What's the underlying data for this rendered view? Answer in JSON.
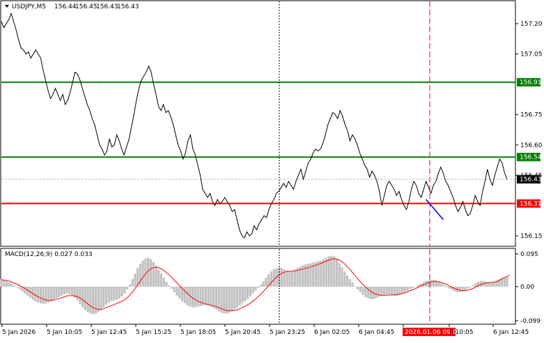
{
  "chart_data": [
    {
      "type": "line",
      "header": {
        "symbol": "USDJPY,M5",
        "ohlc": [
          "156.44",
          "156.45",
          "156.43",
          "156.43"
        ]
      },
      "ylim": [
        156.1,
        157.3
      ],
      "yticks": [
        "157.20",
        "157.05",
        "156.75",
        "156.60",
        "156.45",
        "156.15"
      ],
      "price_labels": [
        {
          "text": "156.91",
          "value": 156.91,
          "color": "#008000"
        },
        {
          "text": "156.54",
          "value": 156.54,
          "color": "#008000"
        },
        {
          "text": "156.43",
          "value": 156.43,
          "color": "#000000"
        },
        {
          "text": "156.31",
          "value": 156.31,
          "color": "#ff0000"
        }
      ],
      "hlines": [
        {
          "value": 156.91,
          "color": "#008000"
        },
        {
          "value": 156.54,
          "color": "#008000"
        },
        {
          "value": 156.31,
          "color": "#ff0000"
        },
        {
          "value": 156.43,
          "color": "#c0c0c0"
        }
      ],
      "x_labels": [
        "5 Jan 2026",
        "5 Jan 10:05",
        "5 Jan 12:45",
        "5 Jan 15:25",
        "5 Jan 18:05",
        "5 Jan 20:45",
        "5 Jan 23:25",
        "6 Jan 02:05",
        "6 Jan 04:45",
        "2026.01.06 09:00",
        "n 10:05",
        "6 Jan 12:45"
      ],
      "x_highlight_label": "2026.01.06 09:00",
      "vlines": [
        {
          "at": "5 Jan 23:25",
          "style": "dotted",
          "color": "#000000"
        },
        {
          "at": "2026.01.06 09:00",
          "style": "dashed",
          "color": "#ff0000"
        }
      ],
      "series": [
        {
          "color": "#000000",
          "y": [
            157.21,
            157.18,
            157.2,
            157.22,
            157.25,
            157.21,
            157.17,
            157.12,
            157.08,
            157.07,
            157.05,
            157.06,
            157.03,
            157.05,
            157.07,
            157.05,
            157.03,
            156.97,
            156.92,
            156.87,
            156.83,
            156.85,
            156.88,
            156.85,
            156.82,
            156.85,
            156.8,
            156.82,
            156.86,
            156.91,
            156.96,
            156.95,
            156.92,
            156.88,
            156.84,
            156.8,
            156.77,
            156.73,
            156.7,
            156.65,
            156.6,
            156.58,
            156.55,
            156.57,
            156.63,
            156.59,
            156.6,
            156.65,
            156.62,
            156.58,
            156.55,
            156.59,
            156.63,
            156.69,
            156.75,
            156.82,
            156.88,
            156.92,
            156.94,
            156.96,
            156.99,
            156.96,
            156.9,
            156.85,
            156.79,
            156.77,
            156.8,
            156.76,
            156.77,
            156.74,
            156.7,
            156.65,
            156.6,
            156.57,
            156.53,
            156.56,
            156.62,
            156.65,
            156.58,
            156.55,
            156.5,
            156.45,
            156.38,
            156.36,
            156.34,
            156.36,
            156.32,
            156.3,
            156.33,
            156.31,
            156.32,
            156.34,
            156.32,
            156.3,
            156.27,
            156.28,
            156.23,
            156.18,
            156.15,
            156.14,
            156.17,
            156.15,
            156.16,
            156.2,
            156.18,
            156.21,
            156.23,
            156.25,
            156.24,
            156.28,
            156.31,
            156.33,
            156.36,
            156.37,
            156.39,
            156.41,
            156.39,
            156.42,
            156.4,
            156.38,
            156.42,
            156.45,
            156.48,
            156.43,
            156.47,
            156.51,
            156.53,
            156.56,
            156.58,
            156.57,
            156.58,
            156.61,
            156.65,
            156.7,
            156.73,
            156.76,
            156.75,
            156.73,
            156.77,
            156.74,
            156.7,
            156.67,
            156.62,
            156.65,
            156.63,
            156.6,
            156.56,
            156.53,
            156.5,
            156.48,
            156.44,
            156.47,
            156.45,
            156.42,
            156.37,
            156.3,
            156.35,
            156.4,
            156.42,
            156.4,
            156.38,
            156.35,
            156.37,
            156.33,
            156.3,
            156.28,
            156.32,
            156.38,
            156.42,
            156.4,
            156.36,
            156.34,
            156.38,
            156.42,
            156.39,
            156.36,
            156.4,
            156.42,
            156.46,
            156.49,
            156.46,
            156.42,
            156.4,
            156.37,
            156.34,
            156.3,
            156.27,
            156.29,
            156.32,
            156.28,
            156.25,
            156.26,
            156.3,
            156.35,
            156.32,
            156.3,
            156.37,
            156.42,
            156.48,
            156.43,
            156.4,
            156.45,
            156.49,
            156.53,
            156.51,
            156.46,
            156.43
          ]
        }
      ],
      "segment": {
        "color": "#0000ff",
        "from_index": 173,
        "to_index": 180,
        "from_value": 156.33,
        "to_value": 156.23
      }
    },
    {
      "type": "bar",
      "title": "MACD(12,26,9) 0.027 0.033",
      "ylim": [
        -0.105,
        0.105
      ],
      "yticks": [
        "0.095",
        "0.00",
        "-0.099"
      ],
      "histogram_color": "#c0c0c0",
      "signal_color": "#ff0000",
      "histogram": [
        0.022,
        0.02,
        0.016,
        0.012,
        0.008,
        0.004,
        -0.002,
        -0.008,
        -0.014,
        -0.02,
        -0.026,
        -0.032,
        -0.038,
        -0.043,
        -0.046,
        -0.048,
        -0.05,
        -0.049,
        -0.046,
        -0.042,
        -0.038,
        -0.034,
        -0.03,
        -0.026,
        -0.022,
        -0.02,
        -0.022,
        -0.026,
        -0.032,
        -0.04,
        -0.05,
        -0.06,
        -0.068,
        -0.074,
        -0.078,
        -0.08,
        -0.079,
        -0.074,
        -0.068,
        -0.06,
        -0.052,
        -0.046,
        -0.042,
        -0.04,
        -0.038,
        -0.034,
        -0.028,
        -0.02,
        -0.008,
        0.006,
        0.022,
        0.038,
        0.054,
        0.066,
        0.076,
        0.082,
        0.084,
        0.08,
        0.072,
        0.062,
        0.05,
        0.038,
        0.026,
        0.014,
        0.004,
        -0.006,
        -0.016,
        -0.026,
        -0.034,
        -0.042,
        -0.048,
        -0.054,
        -0.058,
        -0.06,
        -0.06,
        -0.058,
        -0.056,
        -0.054,
        -0.054,
        -0.056,
        -0.058,
        -0.062,
        -0.066,
        -0.072,
        -0.076,
        -0.078,
        -0.078,
        -0.076,
        -0.072,
        -0.066,
        -0.06,
        -0.054,
        -0.048,
        -0.042,
        -0.036,
        -0.028,
        -0.02,
        -0.012,
        -0.004,
        0.006,
        0.016,
        0.026,
        0.036,
        0.044,
        0.05,
        0.054,
        0.056,
        0.054,
        0.05,
        0.046,
        0.044,
        0.046,
        0.05,
        0.054,
        0.058,
        0.062,
        0.064,
        0.066,
        0.068,
        0.07,
        0.072,
        0.074,
        0.076,
        0.08,
        0.084,
        0.088,
        0.09,
        0.088,
        0.08,
        0.068,
        0.056,
        0.044,
        0.032,
        0.022,
        0.012,
        0.002,
        -0.008,
        -0.016,
        -0.024,
        -0.03,
        -0.034,
        -0.036,
        -0.036,
        -0.034,
        -0.03,
        -0.026,
        -0.024,
        -0.022,
        -0.022,
        -0.024,
        -0.026,
        -0.026,
        -0.024,
        -0.02,
        -0.016,
        -0.012,
        -0.008,
        -0.004,
        0.0,
        0.004,
        0.008,
        0.012,
        0.016,
        0.018,
        0.02,
        0.02,
        0.018,
        0.014,
        0.01,
        0.004,
        -0.002,
        -0.006,
        -0.01,
        -0.014,
        -0.016,
        -0.016,
        -0.014,
        -0.01,
        -0.006,
        -0.002,
        0.004,
        0.01,
        0.014,
        0.016,
        0.016,
        0.014,
        0.012,
        0.012,
        0.014,
        0.018,
        0.022,
        0.026,
        0.027,
        0.028
      ],
      "signal": [
        0.02,
        0.019,
        0.018,
        0.016,
        0.013,
        0.01,
        0.007,
        0.003,
        -0.001,
        -0.005,
        -0.01,
        -0.015,
        -0.02,
        -0.025,
        -0.029,
        -0.033,
        -0.036,
        -0.039,
        -0.04,
        -0.04,
        -0.039,
        -0.037,
        -0.035,
        -0.032,
        -0.029,
        -0.027,
        -0.026,
        -0.026,
        -0.027,
        -0.029,
        -0.033,
        -0.038,
        -0.044,
        -0.05,
        -0.056,
        -0.061,
        -0.064,
        -0.066,
        -0.066,
        -0.064,
        -0.061,
        -0.058,
        -0.055,
        -0.052,
        -0.049,
        -0.046,
        -0.042,
        -0.038,
        -0.032,
        -0.025,
        -0.016,
        -0.006,
        0.005,
        0.016,
        0.027,
        0.037,
        0.046,
        0.052,
        0.055,
        0.056,
        0.055,
        0.052,
        0.047,
        0.041,
        0.034,
        0.027,
        0.019,
        0.011,
        0.003,
        -0.005,
        -0.013,
        -0.02,
        -0.027,
        -0.033,
        -0.038,
        -0.042,
        -0.045,
        -0.048,
        -0.05,
        -0.052,
        -0.054,
        -0.056,
        -0.058,
        -0.061,
        -0.064,
        -0.067,
        -0.069,
        -0.07,
        -0.07,
        -0.069,
        -0.067,
        -0.064,
        -0.061,
        -0.057,
        -0.053,
        -0.048,
        -0.042,
        -0.036,
        -0.029,
        -0.022,
        -0.014,
        -0.006,
        0.003,
        0.012,
        0.02,
        0.028,
        0.034,
        0.039,
        0.042,
        0.044,
        0.045,
        0.045,
        0.046,
        0.047,
        0.049,
        0.051,
        0.053,
        0.055,
        0.057,
        0.06,
        0.062,
        0.065,
        0.068,
        0.071,
        0.074,
        0.077,
        0.08,
        0.081,
        0.08,
        0.077,
        0.072,
        0.066,
        0.058,
        0.05,
        0.041,
        0.032,
        0.023,
        0.014,
        0.006,
        -0.001,
        -0.008,
        -0.014,
        -0.019,
        -0.022,
        -0.024,
        -0.025,
        -0.025,
        -0.025,
        -0.024,
        -0.024,
        -0.024,
        -0.023,
        -0.022,
        -0.02,
        -0.018,
        -0.015,
        -0.012,
        -0.009,
        -0.006,
        -0.002,
        0.002,
        0.005,
        0.009,
        0.012,
        0.014,
        0.015,
        0.015,
        0.014,
        0.012,
        0.009,
        0.006,
        0.002,
        -0.002,
        -0.005,
        -0.008,
        -0.01,
        -0.011,
        -0.011,
        -0.01,
        -0.008,
        -0.005,
        -0.001,
        0.003,
        0.006,
        0.009,
        0.011,
        0.012,
        0.012,
        0.013,
        0.015,
        0.018,
        0.022,
        0.026,
        0.03,
        0.033
      ]
    }
  ]
}
